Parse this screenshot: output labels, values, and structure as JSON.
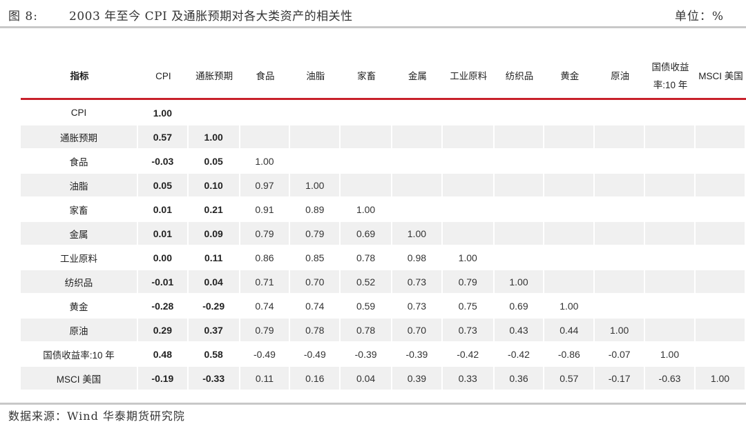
{
  "header": {
    "figure_label": "图 8:",
    "title": "2003 年至今 CPI 及通胀预期对各大类资产的相关性",
    "unit": "单位：%"
  },
  "table": {
    "columns": [
      "指标",
      "CPI",
      "通胀预期",
      "食品",
      "油脂",
      "家畜",
      "金属",
      "工业原料",
      "纺织品",
      "黄金",
      "原油",
      "国债收益率:10 年",
      "MSCI 美国"
    ],
    "rows": [
      {
        "label": "CPI",
        "values": [
          "1.00"
        ]
      },
      {
        "label": "通胀预期",
        "values": [
          "0.57",
          "1.00"
        ]
      },
      {
        "label": "食品",
        "values": [
          "-0.03",
          "0.05",
          "1.00"
        ]
      },
      {
        "label": "油脂",
        "values": [
          "0.05",
          "0.10",
          "0.97",
          "1.00"
        ]
      },
      {
        "label": "家畜",
        "values": [
          "0.01",
          "0.21",
          "0.91",
          "0.89",
          "1.00"
        ]
      },
      {
        "label": "金属",
        "values": [
          "0.01",
          "0.09",
          "0.79",
          "0.79",
          "0.69",
          "1.00"
        ]
      },
      {
        "label": "工业原料",
        "values": [
          "0.00",
          "0.11",
          "0.86",
          "0.85",
          "0.78",
          "0.98",
          "1.00"
        ]
      },
      {
        "label": "纺织品",
        "values": [
          "-0.01",
          "0.04",
          "0.71",
          "0.70",
          "0.52",
          "0.73",
          "0.79",
          "1.00"
        ]
      },
      {
        "label": "黄金",
        "values": [
          "-0.28",
          "-0.29",
          "0.74",
          "0.74",
          "0.59",
          "0.73",
          "0.75",
          "0.69",
          "1.00"
        ]
      },
      {
        "label": "原油",
        "values": [
          "0.29",
          "0.37",
          "0.79",
          "0.78",
          "0.78",
          "0.70",
          "0.73",
          "0.43",
          "0.44",
          "1.00"
        ]
      },
      {
        "label": "国债收益率:10 年",
        "values": [
          "0.48",
          "0.58",
          "-0.49",
          "-0.49",
          "-0.39",
          "-0.39",
          "-0.42",
          "-0.42",
          "-0.86",
          "-0.07",
          "1.00"
        ]
      },
      {
        "label": "MSCI 美国",
        "values": [
          "-0.19",
          "-0.33",
          "0.11",
          "0.16",
          "0.04",
          "0.39",
          "0.33",
          "0.36",
          "0.57",
          "-0.17",
          "-0.63",
          "1.00"
        ]
      }
    ]
  },
  "footer": {
    "source": "数据来源：Wind  华泰期货研究院"
  }
}
